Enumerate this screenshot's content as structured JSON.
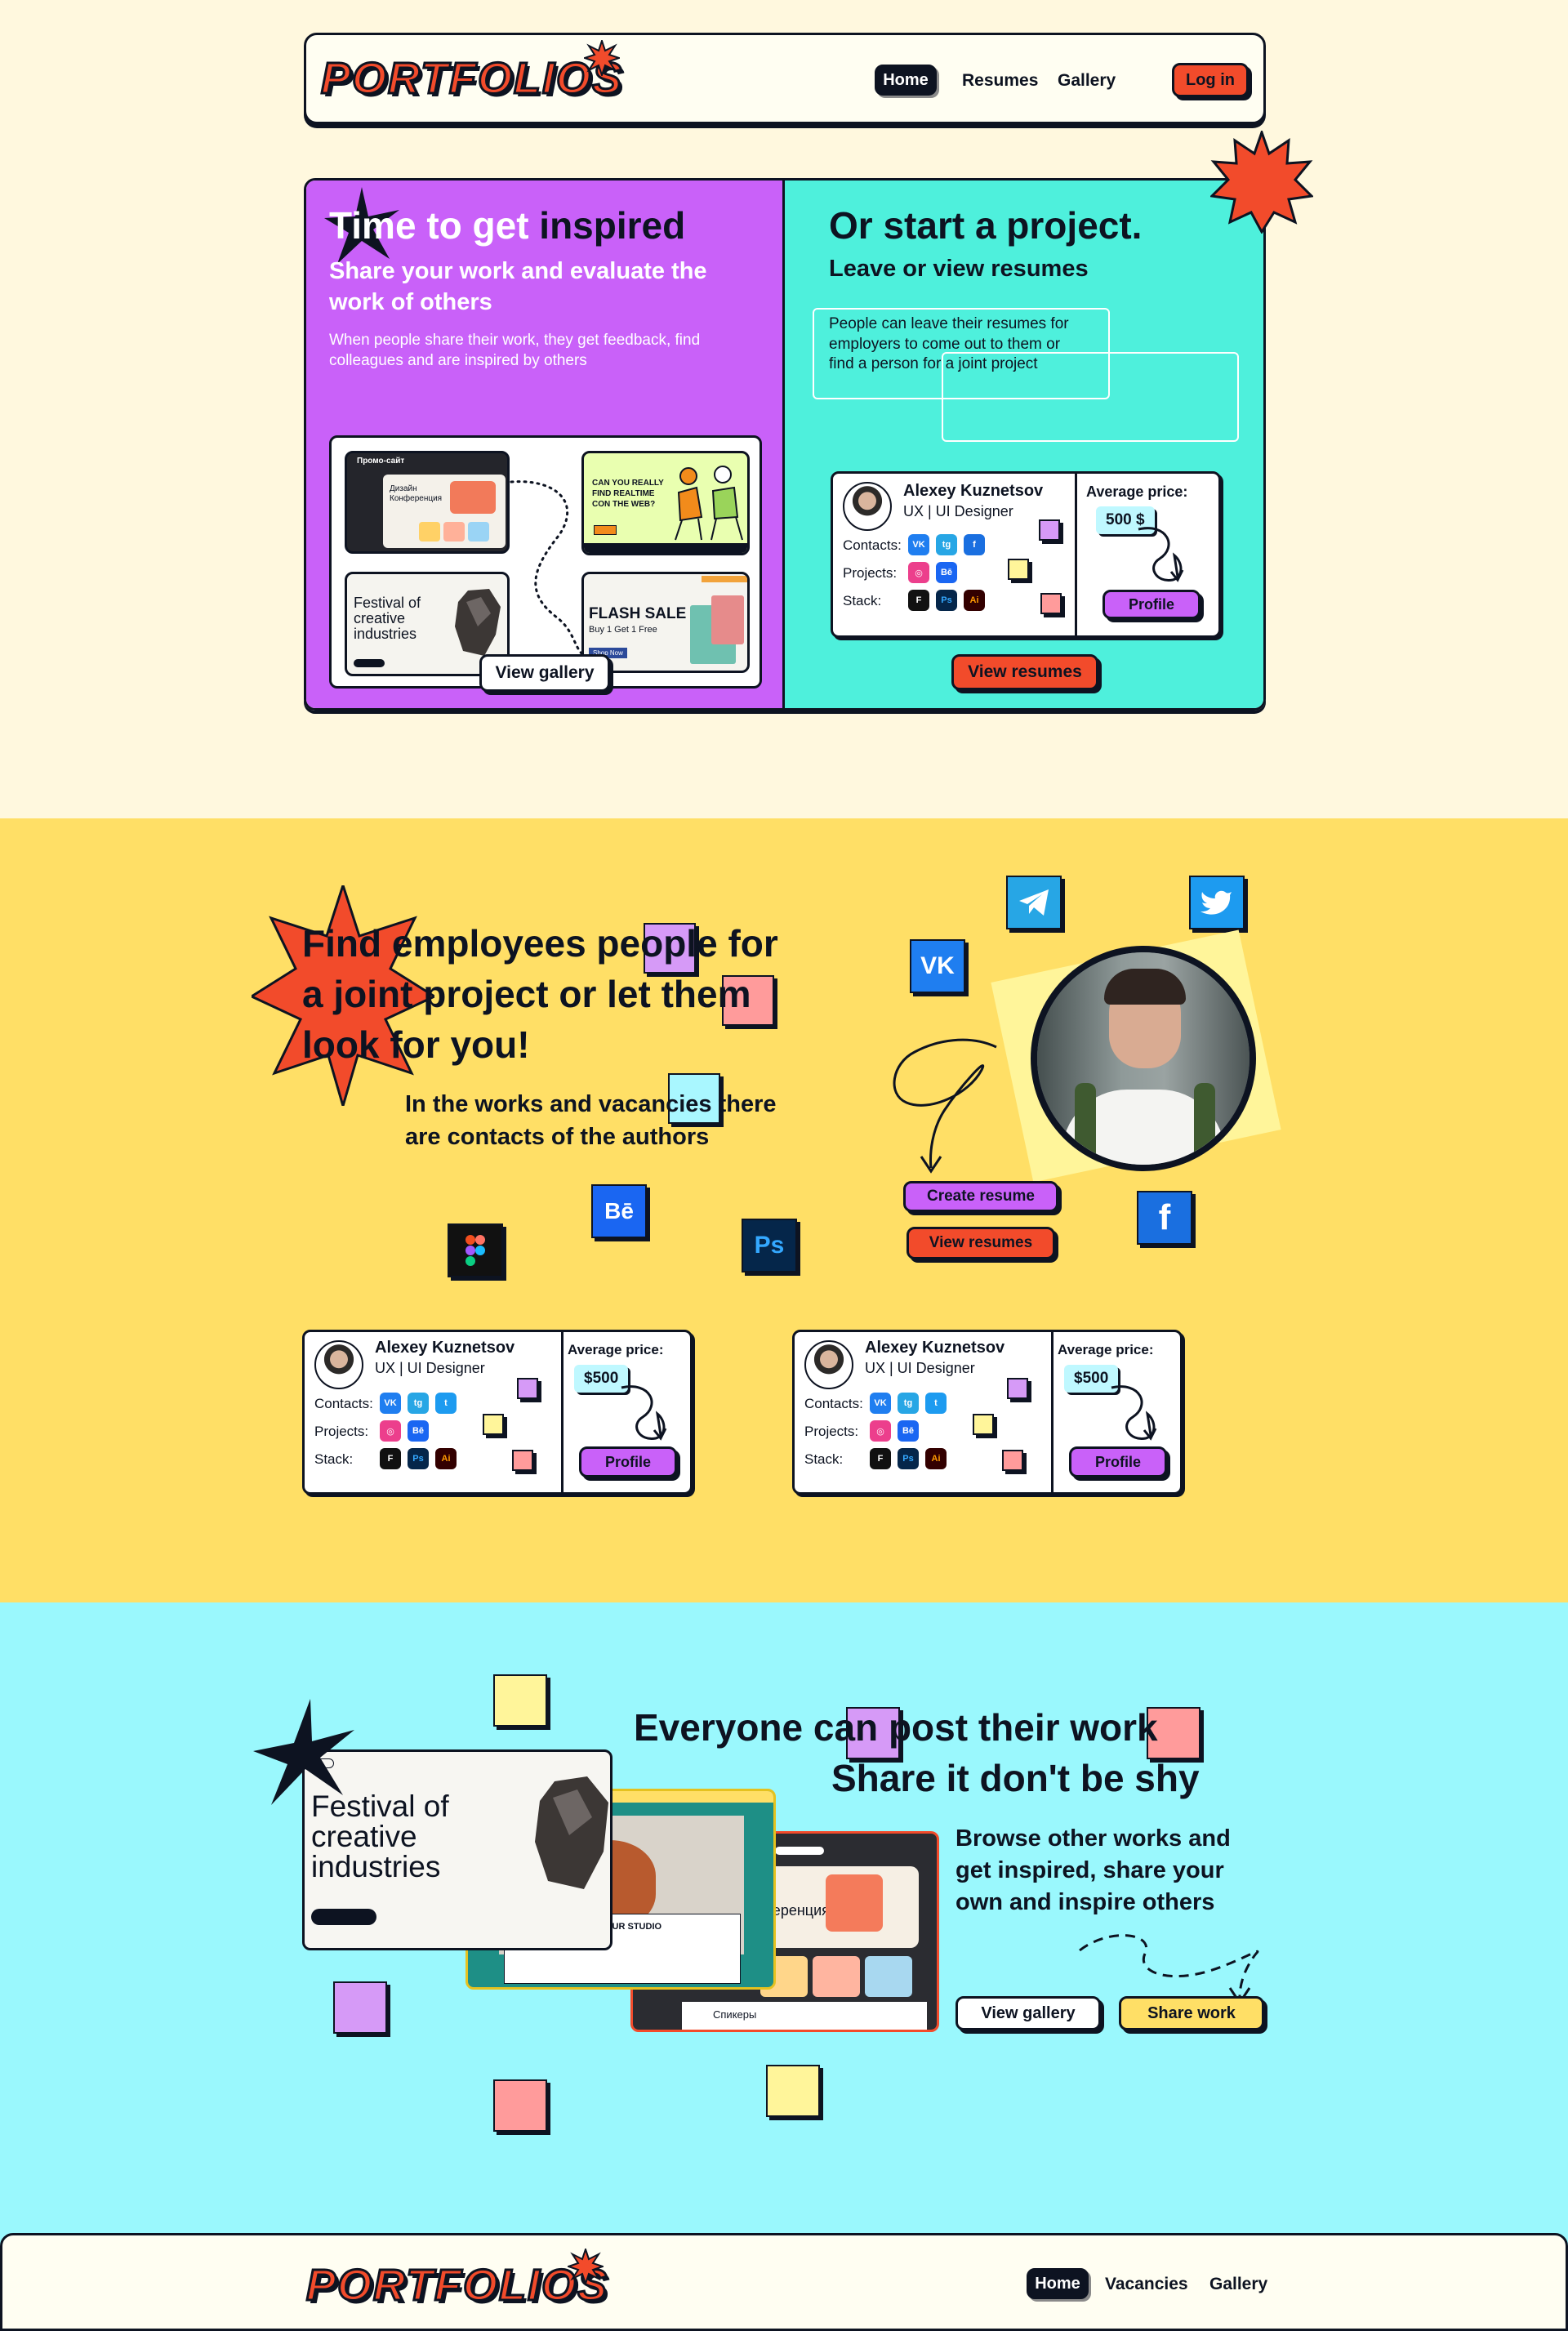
{
  "brand": {
    "logo": "PORTFOLIOS",
    "accent": "#f24b2b",
    "dark": "#0d1321",
    "purple": "#c961f9",
    "cyan": "#4ef0dc",
    "yellow": "#ffdf66",
    "lightcyan": "#9af8fd"
  },
  "nav": {
    "home": "Home",
    "resumes": "Resumes",
    "gallery": "Gallery",
    "login": "Log in"
  },
  "hero": {
    "left": {
      "title_a": "Time to get ",
      "title_b": "inspired",
      "subtitle": "Share your work and evaluate the work of others",
      "text": "When people share their work, they get feedback, find colleagues and are inspired by others",
      "button": "View gallery",
      "thumb1": {
        "label": "Промо-сайт",
        "text": "Дизайн Конференция"
      },
      "thumb2": {
        "title": "CAN YOU REALLY FIND REALTIME CON THE WEB?"
      },
      "thumb3": {
        "title": "Festival of creative industries"
      },
      "thumb4": {
        "title": "FLASH SALE",
        "sub": "Buy 1 Get 1 Free",
        "btn": "Shop Now"
      }
    },
    "right": {
      "title": "Or start a project.",
      "subtitle": "Leave or view resumes",
      "text": "People can leave their resumes for employers to come out to them or find a person for a joint project",
      "button": "View resumes"
    }
  },
  "card": {
    "name": "Alexey Kuznetsov",
    "role": "UX | UI Designer",
    "contacts": "Contacts:",
    "projects": "Projects:",
    "stack": "Stack:",
    "avg": "Average price:",
    "price_hero": "500 $",
    "price": "$500",
    "profile": "Profile"
  },
  "icons": {
    "vk": "VK",
    "tg": "tg",
    "fb": "f",
    "ig": "◎",
    "be": "Bē",
    "fig": "F",
    "ps": "Ps",
    "ai": "Ai",
    "tw": "t"
  },
  "employees": {
    "l1": "Find employees people for",
    "l2": "a joint project or let them",
    "l3": "look for you!",
    "sub1": "In the works and vacancies there",
    "sub2": "are contacts of the authors",
    "create": "Create resume",
    "view": "View resumes"
  },
  "post": {
    "l1": "Everyone can post their work",
    "l2": "Share it don't be shy",
    "text": "Browse other works and get inspired, share your own and inspire others",
    "view": "View gallery",
    "share": "Share work",
    "s1": "Festival of creative industries",
    "s2": "OUR STUDIO",
    "s3": "ференция",
    "s3b": "Спикеры"
  },
  "footer": {
    "home": "Home",
    "vacancies": "Vacancies",
    "gallery": "Gallery"
  }
}
